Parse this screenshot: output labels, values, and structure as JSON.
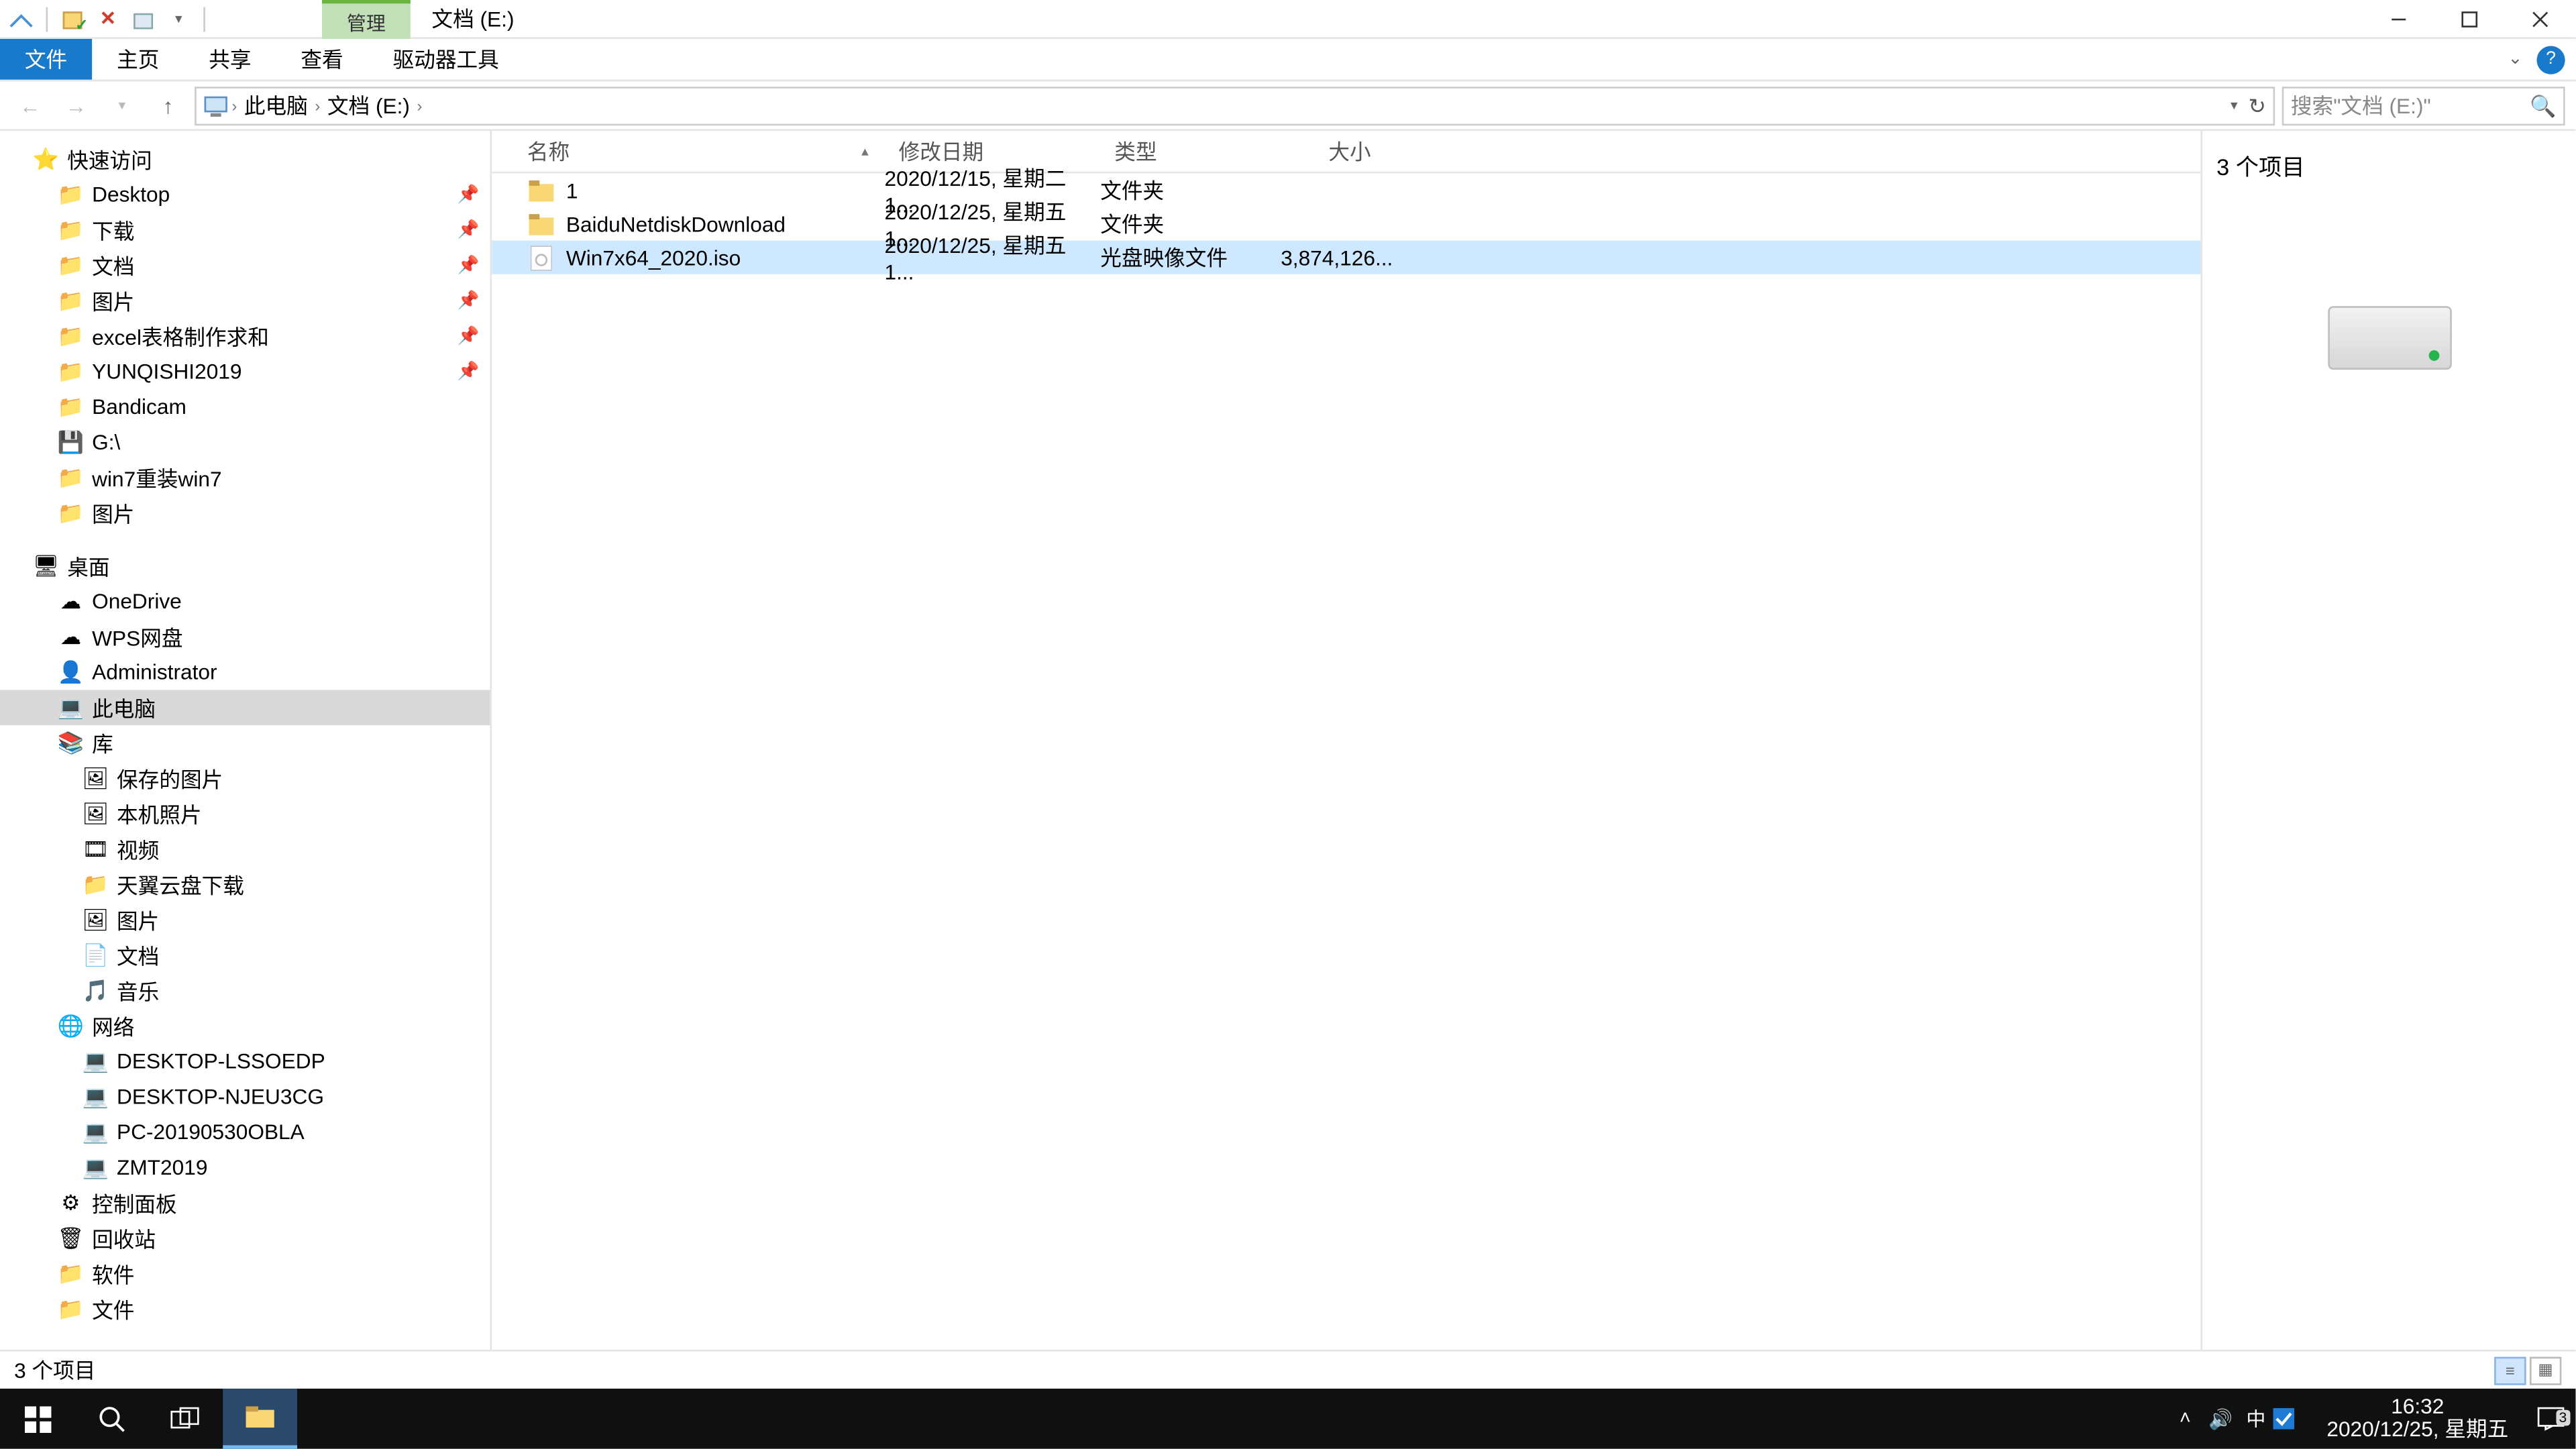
{
  "title": "文档 (E:)",
  "context_tab": "管理",
  "menus": {
    "file": "文件",
    "home": "主页",
    "share": "共享",
    "view": "查看",
    "driver": "驱动器工具"
  },
  "breadcrumb": {
    "root": "此电脑",
    "loc": "文档 (E:)",
    "sep": "›"
  },
  "search_placeholder": "搜索\"文档 (E:)\"",
  "columns": {
    "name": "名称",
    "date": "修改日期",
    "type": "类型",
    "size": "大小"
  },
  "files": [
    {
      "name": "1",
      "date": "2020/12/15, 星期二 1...",
      "type": "文件夹",
      "size": "",
      "kind": "folder"
    },
    {
      "name": "BaiduNetdiskDownload",
      "date": "2020/12/25, 星期五 1...",
      "type": "文件夹",
      "size": "",
      "kind": "folder"
    },
    {
      "name": "Win7x64_2020.iso",
      "date": "2020/12/25, 星期五 1...",
      "type": "光盘映像文件",
      "size": "3,874,126...",
      "kind": "iso",
      "selected": true
    }
  ],
  "preview_title": "3 个项目",
  "status_text": "3 个项目",
  "nav": [
    {
      "d": 0,
      "icon": "star",
      "label": "快速访问"
    },
    {
      "d": 1,
      "icon": "folder",
      "label": "Desktop",
      "pin": true
    },
    {
      "d": 1,
      "icon": "folder",
      "label": "下载",
      "pin": true
    },
    {
      "d": 1,
      "icon": "folder",
      "label": "文档",
      "pin": true
    },
    {
      "d": 1,
      "icon": "folder",
      "label": "图片",
      "pin": true
    },
    {
      "d": 1,
      "icon": "folder",
      "label": "excel表格制作求和",
      "pin": true
    },
    {
      "d": 1,
      "icon": "folder",
      "label": "YUNQISHI2019",
      "pin": true
    },
    {
      "d": 1,
      "icon": "folder",
      "label": "Bandicam"
    },
    {
      "d": 1,
      "icon": "drive",
      "label": "G:\\"
    },
    {
      "d": 1,
      "icon": "folder",
      "label": "win7重装win7"
    },
    {
      "d": 1,
      "icon": "folder",
      "label": "图片"
    },
    {
      "spacer": true
    },
    {
      "d": 0,
      "icon": "desktop",
      "label": "桌面"
    },
    {
      "d": 1,
      "icon": "onedrive",
      "label": "OneDrive"
    },
    {
      "d": 1,
      "icon": "wps",
      "label": "WPS网盘"
    },
    {
      "d": 1,
      "icon": "user",
      "label": "Administrator"
    },
    {
      "d": 1,
      "icon": "pc",
      "label": "此电脑",
      "sel": true
    },
    {
      "d": 1,
      "icon": "lib",
      "label": "库"
    },
    {
      "d": 2,
      "icon": "pic",
      "label": "保存的图片"
    },
    {
      "d": 2,
      "icon": "pic",
      "label": "本机照片"
    },
    {
      "d": 2,
      "icon": "video",
      "label": "视频"
    },
    {
      "d": 2,
      "icon": "folder",
      "label": "天翼云盘下载"
    },
    {
      "d": 2,
      "icon": "pic",
      "label": "图片"
    },
    {
      "d": 2,
      "icon": "doc",
      "label": "文档"
    },
    {
      "d": 2,
      "icon": "music",
      "label": "音乐"
    },
    {
      "d": 1,
      "icon": "net",
      "label": "网络"
    },
    {
      "d": 2,
      "icon": "pcnet",
      "label": "DESKTOP-LSSOEDP"
    },
    {
      "d": 2,
      "icon": "pcnet",
      "label": "DESKTOP-NJEU3CG"
    },
    {
      "d": 2,
      "icon": "pcnet",
      "label": "PC-20190530OBLA"
    },
    {
      "d": 2,
      "icon": "pcnet",
      "label": "ZMT2019"
    },
    {
      "d": 1,
      "icon": "cp",
      "label": "控制面板"
    },
    {
      "d": 1,
      "icon": "rb",
      "label": "回收站"
    },
    {
      "d": 1,
      "icon": "folder",
      "label": "软件"
    },
    {
      "d": 1,
      "icon": "folder",
      "label": "文件"
    }
  ],
  "tray": {
    "ime": "中",
    "time": "16:32",
    "date": "2020/12/25, 星期五",
    "notif_count": "3"
  }
}
